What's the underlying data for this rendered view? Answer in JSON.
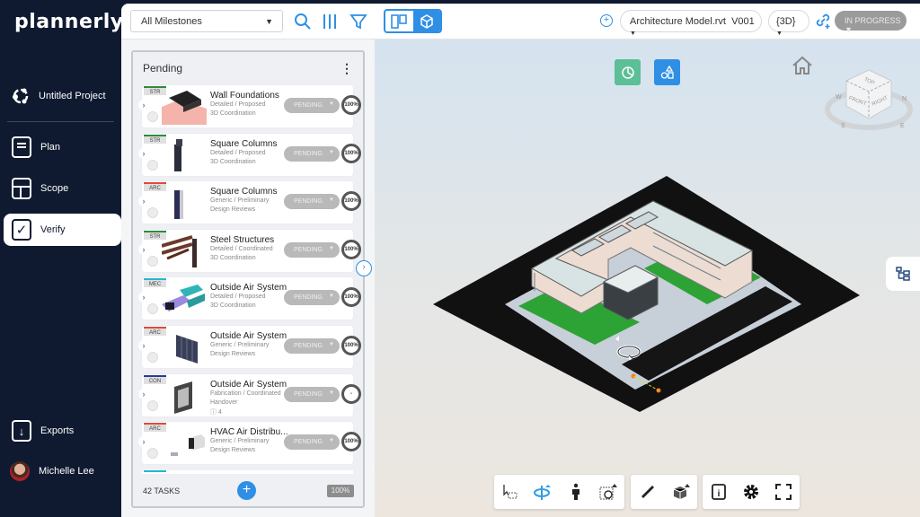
{
  "app": {
    "logo": "plannerly"
  },
  "sidebar": {
    "project": "Untitled Project",
    "items": [
      {
        "label": "Plan",
        "icon": "plan-icon"
      },
      {
        "label": "Scope",
        "icon": "scope-icon"
      },
      {
        "label": "Verify",
        "icon": "verify-checkbox-icon",
        "active": true
      }
    ],
    "exports": "Exports",
    "user": "Michelle Lee"
  },
  "topbar": {
    "milestone_select": "All Milestones",
    "model_select": "Architecture Model.rvt  V001",
    "view_select": "{3D}",
    "status": "IN PROGRESS"
  },
  "panel": {
    "title": "Pending",
    "task_count": "42 TASKS",
    "total_progress": "100%",
    "cards": [
      {
        "tag": "STR",
        "tag_color": "#2e8b3a",
        "title": "Wall Foundations",
        "line1": "Detailed / Proposed",
        "line2": "3D Coordination",
        "line3": "",
        "status": "PENDING",
        "progress": "100%"
      },
      {
        "tag": "STR",
        "tag_color": "#2e8b3a",
        "title": "Square Columns",
        "line1": "Detailed / Proposed",
        "line2": "3D Coordination",
        "line3": "",
        "status": "PENDING",
        "progress": "100%"
      },
      {
        "tag": "ARC",
        "tag_color": "#e04a3a",
        "title": "Square Columns",
        "line1": "Generic / Preliminary",
        "line2": "Design Reviews",
        "line3": "",
        "status": "PENDING",
        "progress": "100%"
      },
      {
        "tag": "STR",
        "tag_color": "#2e8b3a",
        "title": "Steel Structures",
        "line1": "Detailed / Coordinated",
        "line2": "3D Coordination",
        "line3": "",
        "status": "PENDING",
        "progress": "100%"
      },
      {
        "tag": "MEC",
        "tag_color": "#27b6d2",
        "title": "Outside Air System",
        "line1": "Detailed / Proposed",
        "line2": "3D Coordination",
        "line3": "",
        "status": "PENDING",
        "progress": "100%"
      },
      {
        "tag": "ARC",
        "tag_color": "#e04a3a",
        "title": "Outside Air System",
        "line1": "Generic / Preliminary",
        "line2": "Design Reviews",
        "line3": "",
        "status": "PENDING",
        "progress": "100%"
      },
      {
        "tag": "CON",
        "tag_color": "#2a3a9a",
        "title": "Outside Air System",
        "line1": "Fabrication / Coordinated",
        "line2": "Handover",
        "line3": "ⓘ 4",
        "status": "PENDING",
        "progress": "-"
      },
      {
        "tag": "ARC",
        "tag_color": "#e04a3a",
        "title": "HVAC Air Distribu...",
        "line1": "Generic / Preliminary",
        "line2": "Design Reviews",
        "line3": "",
        "status": "PENDING",
        "progress": "100%"
      }
    ]
  },
  "viewer": {
    "viewcube": {
      "top": "TOP",
      "front": "FRONT",
      "right": "RIGHT",
      "compass": [
        "W",
        "N",
        "S",
        "E"
      ]
    },
    "colors": {
      "accent": "#2f8fe5",
      "green_btn": "#5cbf95",
      "nav_bg": "#0f1a30"
    }
  }
}
